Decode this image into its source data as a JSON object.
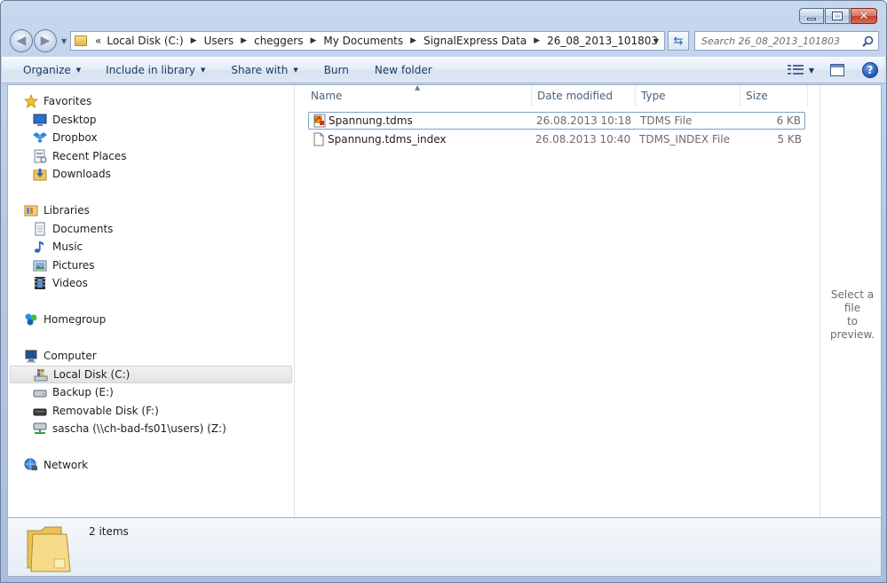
{
  "window": {
    "caption": {
      "minimize": "minimize",
      "maximize": "maximize",
      "close": "close"
    }
  },
  "address": {
    "overflow": "«",
    "breadcrumbs": [
      "Local Disk (C:)",
      "Users",
      "cheggers",
      "My Documents",
      "SignalExpress Data",
      "26_08_2013_101803"
    ]
  },
  "search": {
    "placeholder": "Search 26_08_2013_101803"
  },
  "toolbar": {
    "organize": "Organize",
    "include_in_library": "Include in library",
    "share_with": "Share with",
    "burn": "Burn",
    "new_folder": "New folder"
  },
  "nav": {
    "favorites": {
      "label": "Favorites",
      "items": [
        "Desktop",
        "Dropbox",
        "Recent Places",
        "Downloads"
      ]
    },
    "libraries": {
      "label": "Libraries",
      "items": [
        "Documents",
        "Music",
        "Pictures",
        "Videos"
      ]
    },
    "homegroup": "Homegroup",
    "computer": {
      "label": "Computer",
      "items": [
        "Local Disk (C:)",
        "Backup (E:)",
        "Removable Disk (F:)",
        "sascha (\\\\ch-bad-fs01\\users) (Z:)"
      ],
      "selected": "Local Disk (C:)"
    },
    "network": "Network"
  },
  "columns": {
    "name": "Name",
    "date_modified": "Date modified",
    "type": "Type",
    "size": "Size"
  },
  "files": [
    {
      "name": "Spannung.tdms",
      "date": "26.08.2013 10:18",
      "type": "TDMS File",
      "size": "6 KB",
      "icon": "tdms-file-icon"
    },
    {
      "name": "Spannung.tdms_index",
      "date": "26.08.2013 10:40",
      "type": "TDMS_INDEX File",
      "size": "5 KB",
      "icon": "generic-file-icon"
    }
  ],
  "preview": {
    "line1": "Select a file",
    "line2": "to preview."
  },
  "details": {
    "item_count": "2 items"
  },
  "colors": {
    "accent": "#1e395b",
    "selection_border": "#7da2ce",
    "frame": "#b6c9e4"
  }
}
